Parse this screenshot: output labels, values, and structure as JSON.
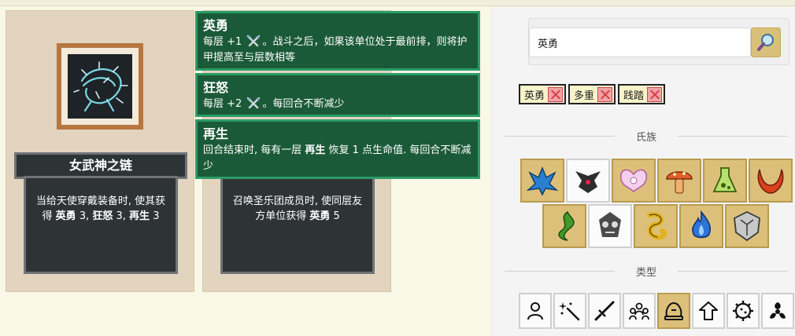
{
  "cards": [
    {
      "name": "女武神之链",
      "desc_parts": [
        "当给天使穿戴装备时, 使其获得 ",
        "英勇",
        " 3, ",
        "狂怒",
        " 3, ",
        "再生",
        " 3"
      ],
      "art": "thorn-chain-icon"
    },
    {
      "desc_parts": [
        "召唤圣乐团成员时, 使同层友方单位获得 ",
        "英勇",
        " 5"
      ]
    }
  ],
  "tooltip": {
    "items": [
      {
        "title": "英勇",
        "body_pre": "每层 +1 ",
        "body_post": "。战斗之后，如果该单位处于最前排，则将护甲提高至与层数相等",
        "icon": "crossed-swords-icon"
      },
      {
        "title": "狂怒",
        "body_pre": "每层 +2 ",
        "body_post": "。每回合不断减少",
        "icon": "crossed-swords-icon"
      },
      {
        "title": "再生",
        "body_pre": "回合结束时, 每有一层 ",
        "body_bold": "再生",
        "body_post": " 恢复 1 点生命值. 每回合不断减少"
      }
    ]
  },
  "search": {
    "value": "英勇",
    "button_icon": "magnifier-icon"
  },
  "filters": {
    "tags": [
      "英勇",
      "多重",
      "践踏"
    ]
  },
  "sections": {
    "tribe": "氏族",
    "type": "类型"
  },
  "tribes": [
    {
      "icon": "hellhorn-icon",
      "selected": false,
      "color": "#2a7fd0"
    },
    {
      "icon": "stygian-icon",
      "selected": true,
      "color": "#2d2d2d"
    },
    {
      "icon": "angel-wings-icon",
      "selected": false,
      "color": "#e6a9d8"
    },
    {
      "icon": "mushroom-icon",
      "selected": false,
      "color": "#e1602c"
    },
    {
      "icon": "flask-icon",
      "selected": false,
      "color": "#8ac53a"
    },
    {
      "icon": "horns-icon",
      "selected": false,
      "color": "#d8401e"
    },
    {
      "icon": "vine-icon",
      "selected": false,
      "color": "#3f9a2a"
    },
    {
      "icon": "remnant-icon",
      "selected": true,
      "color": "#4a4a4a"
    },
    {
      "icon": "serpent-coil-icon",
      "selected": false,
      "color": "#e2b21c"
    },
    {
      "icon": "blue-flame-icon",
      "selected": false,
      "color": "#2e74d8"
    },
    {
      "icon": "stone-shield-icon",
      "selected": false,
      "color": "#9a9a9a"
    }
  ],
  "types": [
    {
      "icon": "person-icon",
      "selected": false
    },
    {
      "icon": "magic-wand-icon",
      "selected": false
    },
    {
      "icon": "sword-icon",
      "selected": false
    },
    {
      "icon": "crowd-icon",
      "selected": false
    },
    {
      "icon": "equipment-icon",
      "selected": true
    },
    {
      "icon": "upgrade-arrow-icon",
      "selected": false
    },
    {
      "icon": "gear-blob-icon",
      "selected": false
    },
    {
      "icon": "biohazard-icon",
      "selected": false
    }
  ]
}
